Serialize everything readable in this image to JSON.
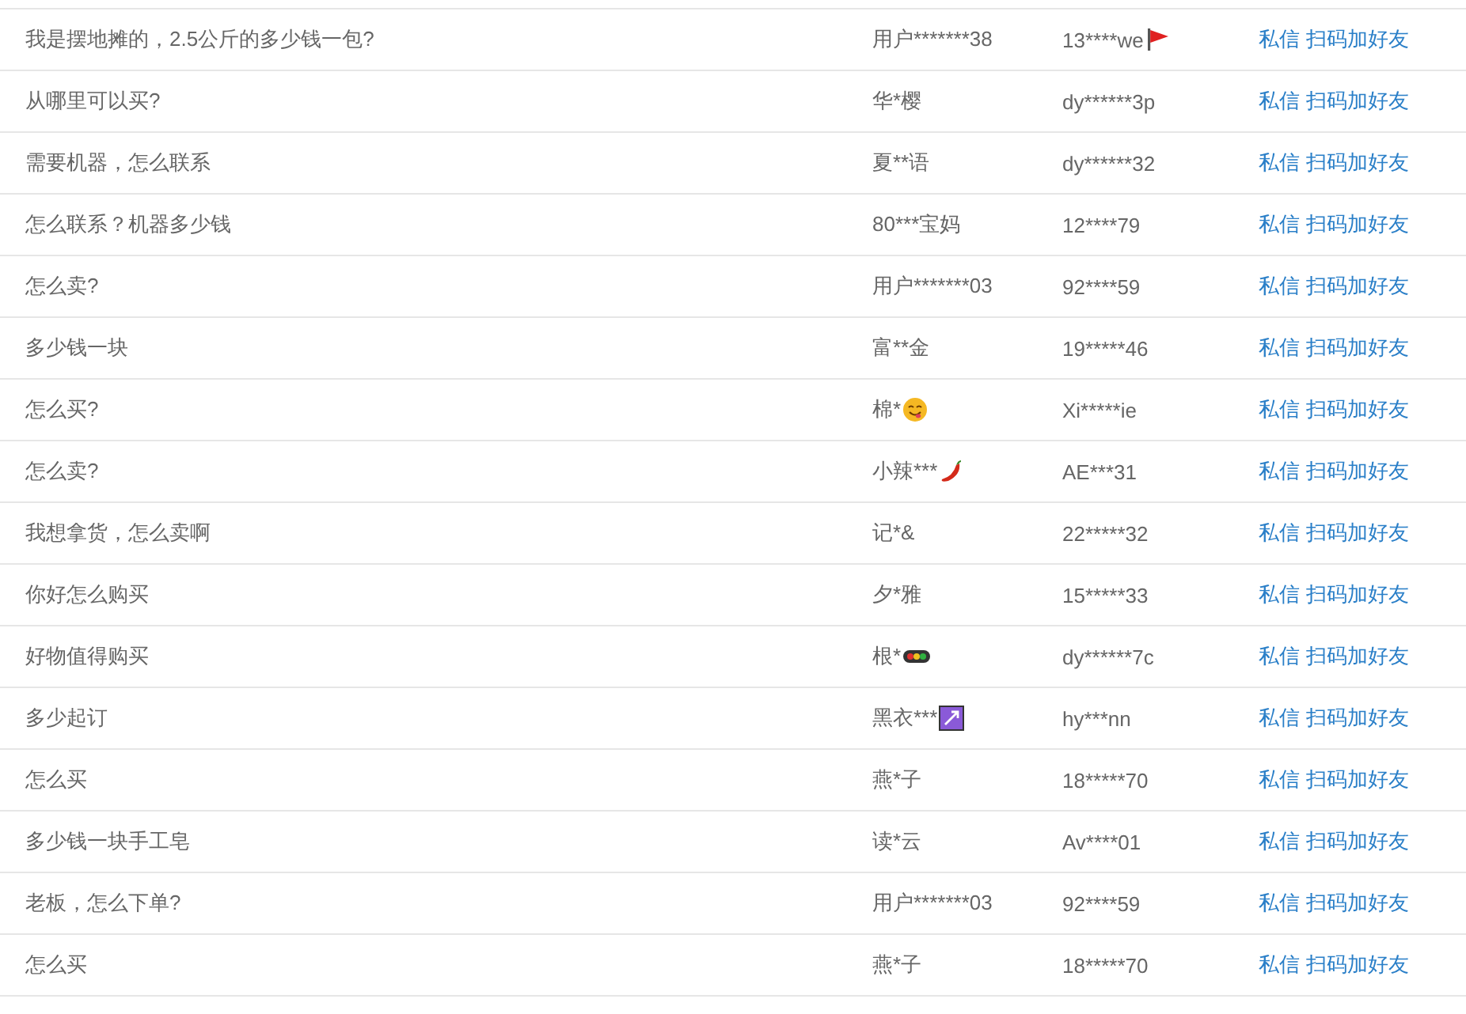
{
  "rows": [
    {
      "question": "我是摆地摊的，2.5公斤的多少钱一包?",
      "user": "用户*******38",
      "uid": "13****we",
      "uid_badge": {
        "kind": "flag"
      },
      "actions": [
        "私信",
        "扫码加好友"
      ]
    },
    {
      "question": "从哪里可以买?",
      "user": "华*樱",
      "uid": "dy******3p",
      "actions": [
        "私信",
        "扫码加好友"
      ]
    },
    {
      "question": "需要机器，怎么联系",
      "user": "夏**语",
      "uid": "dy******32",
      "actions": [
        "私信",
        "扫码加好友"
      ]
    },
    {
      "question": "怎么联系？机器多少钱",
      "user": "80***宝妈",
      "uid": "12****79",
      "actions": [
        "私信",
        "扫码加好友"
      ]
    },
    {
      "question": "怎么卖?",
      "user": "用户*******03",
      "uid": "92****59",
      "actions": [
        "私信",
        "扫码加好友"
      ]
    },
    {
      "question": "多少钱一块",
      "user": "富**金",
      "uid": "19*****46",
      "actions": [
        "私信",
        "扫码加好友"
      ]
    },
    {
      "question": "怎么买?",
      "user": "棉*",
      "user_badge": {
        "kind": "smile"
      },
      "uid": "Xi*****ie",
      "actions": [
        "私信",
        "扫码加好友"
      ]
    },
    {
      "question": "怎么卖?",
      "user": "小辣***",
      "user_badge": {
        "kind": "pepper"
      },
      "uid": "AE***31",
      "actions": [
        "私信",
        "扫码加好友"
      ]
    },
    {
      "question": "我想拿货，怎么卖啊",
      "user": "记*&",
      "uid": "22*****32",
      "actions": [
        "私信",
        "扫码加好友"
      ]
    },
    {
      "question": "你好怎么购买",
      "user": "夕*雅",
      "uid": "15*****33",
      "actions": [
        "私信",
        "扫码加好友"
      ]
    },
    {
      "question": "好物值得购买",
      "user": "根*",
      "user_badge": {
        "kind": "lights"
      },
      "uid": "dy******7c",
      "actions": [
        "私信",
        "扫码加好友"
      ]
    },
    {
      "question": "多少起订",
      "user": "黑衣***",
      "user_badge": {
        "kind": "arrow"
      },
      "uid": "hy***nn",
      "actions": [
        "私信",
        "扫码加好友"
      ]
    },
    {
      "question": "怎么买",
      "user": "燕*子",
      "uid": "18*****70",
      "actions": [
        "私信",
        "扫码加好友"
      ]
    },
    {
      "question": "多少钱一块手工皂",
      "user": "读*云",
      "uid": "Av****01",
      "actions": [
        "私信",
        "扫码加好友"
      ]
    },
    {
      "question": "老板，怎么下单?",
      "user": "用户*******03",
      "uid": "92****59",
      "actions": [
        "私信",
        "扫码加好友"
      ]
    },
    {
      "question": "怎么买",
      "user": "燕*子",
      "uid": "18*****70",
      "actions": [
        "私信",
        "扫码加好友"
      ]
    }
  ]
}
